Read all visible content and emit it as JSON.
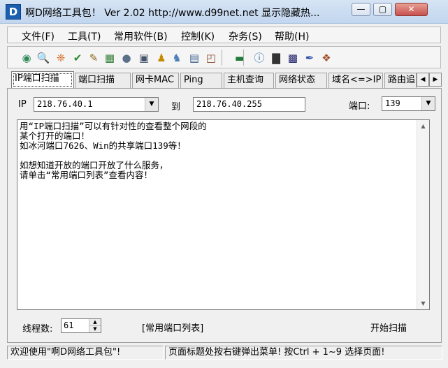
{
  "window": {
    "title": "啊D网络工具包！ Ver 2.02   http://www.d99net.net  显示隐藏热...",
    "icon_letter": "D",
    "min_label": "—",
    "max_label": "▢",
    "close_label": "✕"
  },
  "menu": [
    {
      "label": "文件(F)"
    },
    {
      "label": "工具(T)"
    },
    {
      "label": "常用软件(B)"
    },
    {
      "label": "控制(K)"
    },
    {
      "label": "杂务(S)"
    },
    {
      "label": "帮助(H)"
    }
  ],
  "toolbar_icons": [
    {
      "name": "scan-icon",
      "glyph": "◉",
      "color": "#2e8b57"
    },
    {
      "name": "search-icon",
      "glyph": "🔍",
      "color": "#3a5fcd"
    },
    {
      "name": "network-icon",
      "glyph": "❈",
      "color": "#d2691e"
    },
    {
      "name": "check-icon",
      "glyph": "✔",
      "color": "#2e8b2e"
    },
    {
      "name": "tools-icon",
      "glyph": "✎",
      "color": "#8b6914"
    },
    {
      "name": "chart-icon",
      "glyph": "▦",
      "color": "#2f7d32"
    },
    {
      "name": "globe-icon",
      "glyph": "●",
      "color": "#5a6f8a"
    },
    {
      "name": "computers-icon",
      "glyph": "▣",
      "color": "#44546a"
    },
    {
      "name": "user-icon",
      "glyph": "♟",
      "color": "#c58b00"
    },
    {
      "name": "users-icon",
      "glyph": "♞",
      "color": "#4a7ab5"
    },
    {
      "name": "server-icon",
      "glyph": "▤",
      "color": "#40638f"
    },
    {
      "name": "window-icon",
      "glyph": "◰",
      "color": "#8c4a2f"
    },
    {
      "name": "board-icon",
      "glyph": "▬",
      "color": "#1f7a3a"
    },
    {
      "name": "info-icon",
      "glyph": "ⓘ",
      "color": "#2b6cb0"
    },
    {
      "name": "monitor-icon",
      "glyph": "▇",
      "color": "#333333"
    },
    {
      "name": "terminal-icon",
      "glyph": "▩",
      "color": "#1a1a6a"
    },
    {
      "name": "pen-icon",
      "glyph": "✒",
      "color": "#2b4fa3"
    },
    {
      "name": "group-icon",
      "glyph": "❖",
      "color": "#a0522d"
    }
  ],
  "tabs": [
    {
      "label": "IP端口扫描",
      "active": true
    },
    {
      "label": "端口扫描"
    },
    {
      "label": "网卡MAC"
    },
    {
      "label": "Ping"
    },
    {
      "label": "主机查询"
    },
    {
      "label": "网络状态"
    },
    {
      "label": "域名<=>IP"
    },
    {
      "label": "路由追"
    }
  ],
  "tab_scroll": {
    "left": "◀",
    "right": "▶"
  },
  "form": {
    "ip_label": "IP",
    "ip_from": "218.76.40.1",
    "to_label": "到",
    "ip_to": "218.76.40.255",
    "port_label": "端口:",
    "port_value": "139"
  },
  "memo_text": "用“IP端口扫描”可以有针对性的查看整个网段的\n某个打开的端口！\n如冰河端口7626、Win的共享端口139等！\n\n如想知道开放的端口开放了什么服务，\n请单击“常用端口列表”查看内容！",
  "threads": {
    "label": "线程数:",
    "value": "61"
  },
  "port_list_button": "[常用端口列表]",
  "start_scan_button": "开始扫描",
  "status": {
    "left": "欢迎使用\"啊D网络工具包\"!",
    "right": "页面标题处按右键弹出菜单! 按Ctrl + 1~9  选择页面!"
  }
}
